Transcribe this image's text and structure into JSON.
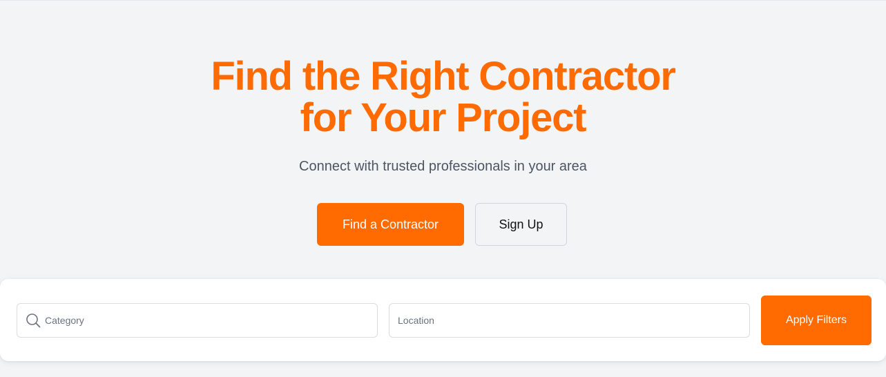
{
  "hero": {
    "title_line1": "Find the Right Contractor",
    "title_line2": "for Your Project",
    "subtitle": "Connect with trusted professionals in your area",
    "primary_button": "Find a Contractor",
    "secondary_button": "Sign Up"
  },
  "filters": {
    "category_placeholder": "Category",
    "category_icon": "search-icon",
    "location_placeholder": "Location",
    "apply_button": "Apply Filters"
  },
  "colors": {
    "accent": "#ff6b00",
    "background": "#f3f4f6",
    "subtitle_text": "#4b5563"
  }
}
